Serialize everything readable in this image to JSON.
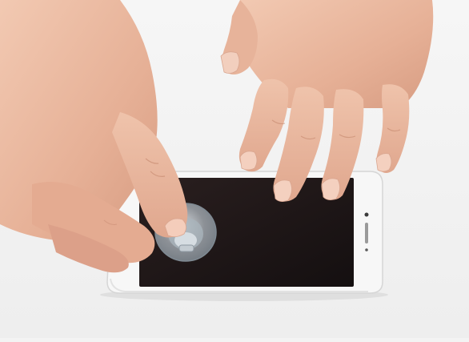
{
  "scene": {
    "background_color": "#f3f3f3",
    "skin_color": "#e9b89f",
    "skin_shadow_color": "#c98d74",
    "phone_body_color": "#f7f7f7",
    "phone_screen_color": "#1a1414",
    "suction_cup_color": "#cfd6dc"
  },
  "caption": ""
}
